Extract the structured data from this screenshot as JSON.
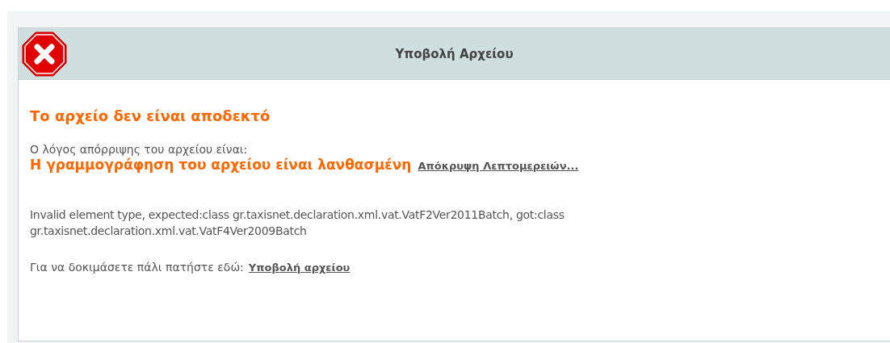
{
  "dialog": {
    "title": "Υποβολή Αρχείου"
  },
  "heading": "Το αρχείο δεν είναι αποδεκτό",
  "reason_label": "Ο λόγος απόρριψης του αρχείου είναι:",
  "reason": "Η γραμμογράφηση του αρχείου είναι λανθασμένη",
  "details_link": "Απόκρυψη Λεπτομερειών...",
  "details_lines": [
    "Invalid element type, expected:class gr.taxisnet.declaration.xml.vat.VatF2Ver2011Batch, got:class",
    "gr.taxisnet.declaration.xml.vat.VatF4Ver2009Batch"
  ],
  "retry_text": "Για να δοκιμάσετε πάλι πατήστε εδώ:",
  "retry_link": "Υποβολή αρχείου"
}
